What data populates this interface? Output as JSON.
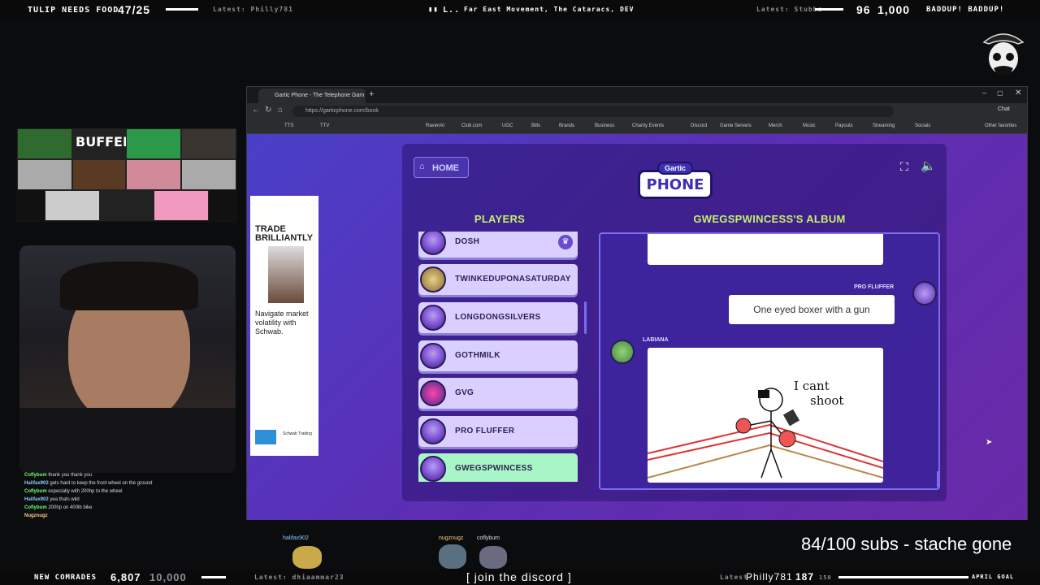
{
  "topbar": {
    "goal_label": "TULIP NEEDS FOOD",
    "goal_count": "47/25",
    "latest_left": "Latest: Philly781",
    "song_icon": "L..",
    "song": "Far East Movement, The Cataracs, DEV",
    "latest_right": "Latest: Stubbz",
    "count_a": "96",
    "count_b": "1,000",
    "right_text": "BADDUP! BADDUP!"
  },
  "bottombar": {
    "label": "NEW COMRADES",
    "count": "6,807",
    "goal": "10,000",
    "latest": "Latest: dhiaammar23",
    "discord": "[ join the discord ]",
    "latest2": "Latest:",
    "user2": "Philly781",
    "n2": "187",
    "n2goal": "150",
    "april": "APRIL GOAL"
  },
  "overlay": {
    "subs": "84/100 subs - stache gone",
    "names": [
      "halifax902",
      "nugznugz",
      "coflybum"
    ]
  },
  "chat": [
    {
      "user": "Coflybum",
      "msg": "thank you thank you"
    },
    {
      "user": "Halifax902",
      "msg": "gets hard to keep the front wheel on the ground"
    },
    {
      "user": "Coflybum",
      "msg": "especially with 200hp to the wheel"
    },
    {
      "user": "Halifax902",
      "msg": "yea thats wild"
    },
    {
      "user": "Coflybum",
      "msg": "200hp on 400lb bike"
    },
    {
      "user": "Nugznugz",
      "msg": ""
    }
  ],
  "browser": {
    "tab_title": "Gartic Phone - The Telephone Gam",
    "url": "https://garticphone.com/book",
    "bookmarks": [
      "TTS",
      "TTV",
      "RavenAI",
      "Club.com",
      "UGC",
      "Bills",
      "Brands",
      "Business",
      "Charity Events",
      "Discord",
      "Game Servers",
      "Merch",
      "Music",
      "Payouts",
      "Streaming",
      "Socials",
      "Other favorites"
    ],
    "chat_label": "Chat"
  },
  "ad": {
    "headline": "TRADE BRILLIANTLY",
    "caption": "Navigate market volatility with Schwab.",
    "brand": "Schwab Trading"
  },
  "game": {
    "home": "HOME",
    "logo_top": "Gartic",
    "logo_bottom": "PHONE",
    "players_title": "PLAYERS",
    "album_title": "GWEGSPWINCESS'S ALBUM",
    "players": [
      "DOSH",
      "TWINKEDUPONASATURDAY",
      "LONGDONGSILVERS",
      "GOTHMILK",
      "GVG",
      "PRO FLUFFER",
      "GWEGSPWINCESS"
    ],
    "msg_author": "PRO FLUFFER",
    "msg_text": "One eyed boxer with a gun",
    "draw_author": "LABIANA",
    "drawing_text_1": "I cant",
    "drawing_text_2": "shoot"
  },
  "colors": {
    "accent_green": "#c6f06a",
    "active_player": "#a8f5c8",
    "purple_bg": "#4a3fc8"
  }
}
